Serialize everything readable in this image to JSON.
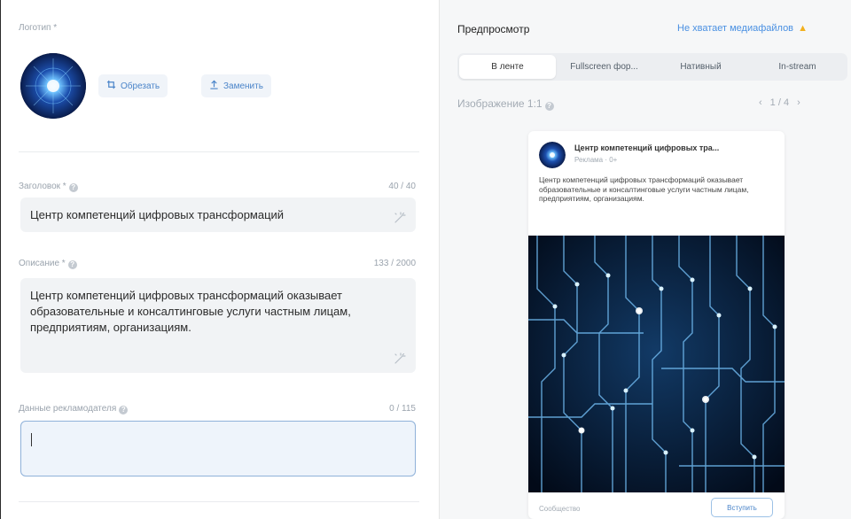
{
  "logo_section": {
    "label": "Логотип *",
    "crop_button": "Обрезать",
    "replace_button": "Заменить"
  },
  "headline": {
    "label": "Заголовок *",
    "counter": "40 / 40",
    "value": "Центр компетенций цифровых трансформаций"
  },
  "description": {
    "label": "Описание *",
    "counter": "133 / 2000",
    "value": "Центр компетенций цифровых трансформаций оказывает образовательные и консалтинговые услуги частным лицам, предприятиям, организациям."
  },
  "advertiser": {
    "label": "Данные рекламодателя",
    "counter": "0 / 115",
    "value": ""
  },
  "preview": {
    "title": "Предпросмотр",
    "warning": "Не хватает медиафайлов",
    "tabs": [
      {
        "label": "В ленте",
        "active": true
      },
      {
        "label": "Fullscreen фор...",
        "active": false
      },
      {
        "label": "Нативный",
        "active": false
      },
      {
        "label": "In-stream",
        "active": false
      }
    ],
    "format_label": "Изображение 1:1",
    "pager": "1 / 4",
    "card": {
      "name": "Центр компетенций цифровых тра...",
      "meta": "Реклама · 0+",
      "text": "Центр компетенций цифровых трансформаций оказывает образовательные и консалтинговые услуги частным лицам, предприятиям, организациям.",
      "footer": "Сообщество",
      "button": "Вступить"
    }
  },
  "colors": {
    "accent": "#4a84c9",
    "warning_icon": "#f2b01e",
    "muted": "#9aa3ad"
  }
}
